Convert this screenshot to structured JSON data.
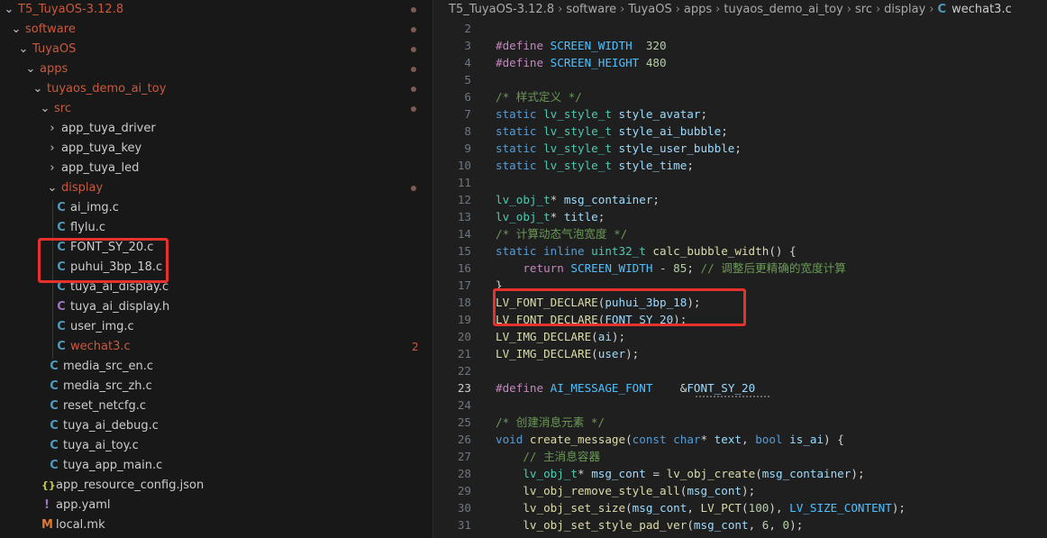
{
  "explorer": {
    "items": [
      {
        "label": "T5_TuyaOS-3.12.8",
        "kind": "folder-open",
        "depth": 0,
        "dot": true
      },
      {
        "label": "software",
        "kind": "folder-open",
        "depth": 1,
        "dot": true
      },
      {
        "label": "TuyaOS",
        "kind": "folder-open",
        "depth": 2,
        "dot": true
      },
      {
        "label": "apps",
        "kind": "folder-open",
        "depth": 3,
        "dot": true
      },
      {
        "label": "tuyaos_demo_ai_toy",
        "kind": "folder-open",
        "depth": 4,
        "dot": true
      },
      {
        "label": "src",
        "kind": "folder-open",
        "depth": 5,
        "dot": true
      },
      {
        "label": "app_tuya_driver",
        "kind": "folder",
        "depth": 6
      },
      {
        "label": "app_tuya_key",
        "kind": "folder",
        "depth": 6
      },
      {
        "label": "app_tuya_led",
        "kind": "folder",
        "depth": 6
      },
      {
        "label": "display",
        "kind": "folder-open",
        "depth": 6,
        "dot": true
      },
      {
        "label": "ai_img.c",
        "kind": "c",
        "depth": 7
      },
      {
        "label": "flylu.c",
        "kind": "c",
        "depth": 7
      },
      {
        "label": "FONT_SY_20.c",
        "kind": "c",
        "depth": 7
      },
      {
        "label": "puhui_3bp_18.c",
        "kind": "c",
        "depth": 7
      },
      {
        "label": "tuya_ai_display.c",
        "kind": "c",
        "depth": 7
      },
      {
        "label": "tuya_ai_display.h",
        "kind": "h",
        "depth": 7
      },
      {
        "label": "user_img.c",
        "kind": "c",
        "depth": 7
      },
      {
        "label": "wechat3.c",
        "kind": "c-modified",
        "depth": 7,
        "badge": "2"
      },
      {
        "label": "media_src_en.c",
        "kind": "c",
        "depth": 6
      },
      {
        "label": "media_src_zh.c",
        "kind": "c",
        "depth": 6
      },
      {
        "label": "reset_netcfg.c",
        "kind": "c",
        "depth": 6
      },
      {
        "label": "tuya_ai_debug.c",
        "kind": "c",
        "depth": 6
      },
      {
        "label": "tuya_ai_toy.c",
        "kind": "c",
        "depth": 6
      },
      {
        "label": "tuya_app_main.c",
        "kind": "c",
        "depth": 6
      },
      {
        "label": "app_resource_config.json",
        "kind": "json",
        "depth": 5
      },
      {
        "label": "app.yaml",
        "kind": "yaml",
        "depth": 5
      },
      {
        "label": "local.mk",
        "kind": "mk",
        "depth": 5
      }
    ],
    "icons": {
      "c": "C",
      "h": "C",
      "json": "{}",
      "yaml": "!",
      "mk": "M",
      "chevron_open": "⌄",
      "chevron_closed": "›"
    }
  },
  "editor": {
    "breadcrumb": [
      "T5_TuyaOS-3.12.8",
      "software",
      "TuyaOS",
      "apps",
      "tuyaos_demo_ai_toy",
      "src",
      "display"
    ],
    "breadcrumb_file_icon": "C",
    "breadcrumb_file": "wechat3.c",
    "active_line": 23,
    "lines": [
      {
        "n": "2",
        "t": []
      },
      {
        "n": "3",
        "t": [
          [
            "pp",
            "#define "
          ],
          [
            "const",
            "SCREEN_WIDTH"
          ],
          [
            "p",
            "  "
          ],
          [
            "num",
            "320"
          ]
        ]
      },
      {
        "n": "4",
        "t": [
          [
            "pp",
            "#define "
          ],
          [
            "const",
            "SCREEN_HEIGHT"
          ],
          [
            "p",
            " "
          ],
          [
            "num",
            "480"
          ]
        ]
      },
      {
        "n": "5",
        "t": []
      },
      {
        "n": "6",
        "t": [
          [
            "cmt",
            "/* 样式定义 */"
          ]
        ]
      },
      {
        "n": "7",
        "t": [
          [
            "kw",
            "static "
          ],
          [
            "type",
            "lv_style_t "
          ],
          [
            "var",
            "style_avatar"
          ],
          [
            "p",
            ";"
          ]
        ]
      },
      {
        "n": "8",
        "t": [
          [
            "kw",
            "static "
          ],
          [
            "type",
            "lv_style_t "
          ],
          [
            "var",
            "style_ai_bubble"
          ],
          [
            "p",
            ";"
          ]
        ]
      },
      {
        "n": "9",
        "t": [
          [
            "kw",
            "static "
          ],
          [
            "type",
            "lv_style_t "
          ],
          [
            "var",
            "style_user_bubble"
          ],
          [
            "p",
            ";"
          ]
        ]
      },
      {
        "n": "10",
        "t": [
          [
            "kw",
            "static "
          ],
          [
            "type",
            "lv_style_t "
          ],
          [
            "var",
            "style_time"
          ],
          [
            "p",
            ";"
          ]
        ]
      },
      {
        "n": "11",
        "t": []
      },
      {
        "n": "12",
        "t": [
          [
            "type",
            "lv_obj_t"
          ],
          [
            "p",
            "* "
          ],
          [
            "var",
            "msg_container"
          ],
          [
            "p",
            ";"
          ]
        ]
      },
      {
        "n": "13",
        "t": [
          [
            "type",
            "lv_obj_t"
          ],
          [
            "p",
            "* "
          ],
          [
            "var",
            "title"
          ],
          [
            "p",
            ";"
          ]
        ]
      },
      {
        "n": "14",
        "t": [
          [
            "cmt",
            "/* 计算动态气泡宽度 */"
          ]
        ]
      },
      {
        "n": "15",
        "t": [
          [
            "kw",
            "static inline "
          ],
          [
            "type",
            "uint32_t "
          ],
          [
            "fn",
            "calc_bubble_width"
          ],
          [
            "p",
            "() {"
          ]
        ]
      },
      {
        "n": "16",
        "t": [
          [
            "p",
            "    "
          ],
          [
            "kw-pp",
            "return "
          ],
          [
            "const",
            "SCREEN_WIDTH"
          ],
          [
            "p",
            " - "
          ],
          [
            "num",
            "85"
          ],
          [
            "p",
            "; "
          ],
          [
            "cmt",
            "// 调整后更精确的宽度计算"
          ]
        ]
      },
      {
        "n": "17",
        "t": [
          [
            "p",
            "}"
          ]
        ]
      },
      {
        "n": "18",
        "t": [
          [
            "fn",
            "LV_FONT_DECLARE"
          ],
          [
            "p",
            "("
          ],
          [
            "var",
            "puhui_3bp_18"
          ],
          [
            "p",
            ");"
          ]
        ]
      },
      {
        "n": "19",
        "t": [
          [
            "fn",
            "LV_FONT_DECLARE"
          ],
          [
            "p",
            "("
          ],
          [
            "var",
            "FONT_SY_20"
          ],
          [
            "p",
            ");"
          ]
        ]
      },
      {
        "n": "20",
        "t": [
          [
            "fn",
            "LV_IMG_DECLARE"
          ],
          [
            "p",
            "("
          ],
          [
            "var",
            "ai"
          ],
          [
            "p",
            ");"
          ]
        ]
      },
      {
        "n": "21",
        "t": [
          [
            "fn",
            "LV_IMG_DECLARE"
          ],
          [
            "p",
            "("
          ],
          [
            "var",
            "user"
          ],
          [
            "p",
            ");"
          ]
        ]
      },
      {
        "n": "22",
        "t": []
      },
      {
        "n": "23",
        "t": [
          [
            "pp",
            "#define "
          ],
          [
            "const",
            "AI_MESSAGE_FONT"
          ],
          [
            "p",
            "    &"
          ],
          [
            "var",
            "FONT_SY_20"
          ]
        ]
      },
      {
        "n": "24",
        "t": []
      },
      {
        "n": "25",
        "t": [
          [
            "cmt",
            "/* 创建消息元素 */"
          ]
        ]
      },
      {
        "n": "26",
        "t": [
          [
            "kw",
            "void "
          ],
          [
            "fn",
            "create_message"
          ],
          [
            "p",
            "("
          ],
          [
            "kw",
            "const char"
          ],
          [
            "p",
            "* "
          ],
          [
            "var",
            "text"
          ],
          [
            "p",
            ", "
          ],
          [
            "kw",
            "bool "
          ],
          [
            "var",
            "is_ai"
          ],
          [
            "p",
            ") {"
          ]
        ]
      },
      {
        "n": "27",
        "t": [
          [
            "p",
            "    "
          ],
          [
            "cmt",
            "// 主消息容器"
          ]
        ]
      },
      {
        "n": "28",
        "t": [
          [
            "p",
            "    "
          ],
          [
            "type",
            "lv_obj_t"
          ],
          [
            "p",
            "* "
          ],
          [
            "var",
            "msg_cont"
          ],
          [
            "p",
            " = "
          ],
          [
            "fn",
            "lv_obj_create"
          ],
          [
            "p",
            "("
          ],
          [
            "var",
            "msg_container"
          ],
          [
            "p",
            ");"
          ]
        ]
      },
      {
        "n": "29",
        "t": [
          [
            "p",
            "    "
          ],
          [
            "fn",
            "lv_obj_remove_style_all"
          ],
          [
            "p",
            "("
          ],
          [
            "var",
            "msg_cont"
          ],
          [
            "p",
            ");"
          ]
        ]
      },
      {
        "n": "30",
        "t": [
          [
            "p",
            "    "
          ],
          [
            "fn",
            "lv_obj_set_size"
          ],
          [
            "p",
            "("
          ],
          [
            "var",
            "msg_cont"
          ],
          [
            "p",
            ", "
          ],
          [
            "fn",
            "LV_PCT"
          ],
          [
            "p",
            "("
          ],
          [
            "num",
            "100"
          ],
          [
            "p",
            "), "
          ],
          [
            "const",
            "LV_SIZE_CONTENT"
          ],
          [
            "p",
            ");"
          ]
        ]
      },
      {
        "n": "31",
        "t": [
          [
            "p",
            "    "
          ],
          [
            "fn",
            "lv_obj_set_style_pad_ver"
          ],
          [
            "p",
            "("
          ],
          [
            "var",
            "msg_cont"
          ],
          [
            "p",
            ", "
          ],
          [
            "num",
            "6"
          ],
          [
            "p",
            ", "
          ],
          [
            "num",
            "0"
          ],
          [
            "p",
            ");"
          ]
        ]
      }
    ]
  }
}
